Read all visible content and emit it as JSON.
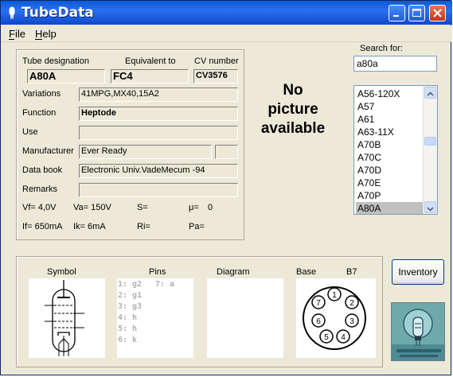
{
  "window": {
    "title": "TubeData",
    "controls": [
      "minimize",
      "maximize",
      "close"
    ]
  },
  "menu": [
    {
      "label": "File",
      "key": "F"
    },
    {
      "label": "Help",
      "key": "H"
    }
  ],
  "info": {
    "labels": {
      "designation": "Tube designation",
      "equivalent": "Equivalent to",
      "cv": "CV number",
      "variations": "Variations",
      "function": "Function",
      "use": "Use",
      "manufacturer": "Manufacturer",
      "databook": "Data book",
      "remarks": "Remarks"
    },
    "values": {
      "designation": "A80A",
      "equivalent": "FC4",
      "cv": "CV3576",
      "variations": "41MPG,MX40,15A2",
      "function": "Heptode",
      "use": "",
      "manufacturer": "Ever Ready",
      "manufacturer_extra": "",
      "databook": "Electronic Univ.VadeMecum -94",
      "remarks": ""
    },
    "params": {
      "vf": "Vf= 4,0V",
      "va": "Va= 150V",
      "s": "S=",
      "mu": "μ=",
      "mu_value": "0",
      "if": "If= 650mA",
      "ik": "Ik= 6mA",
      "ri": "Ri=",
      "pa": "Pa="
    }
  },
  "no_picture": {
    "line1": "No",
    "line2": "picture",
    "line3": "available"
  },
  "search": {
    "label": "Search for:",
    "value": "a80a"
  },
  "tube_list": {
    "items": [
      "A56-120X",
      "A57",
      "A61",
      "A63-11X",
      "A70B",
      "A70C",
      "A70D",
      "A70E",
      "A70P",
      "A80A"
    ],
    "selected": "A80A"
  },
  "bottom": {
    "headers": {
      "symbol": "Symbol",
      "pins": "Pins",
      "diagram": "Diagram",
      "base": "Base",
      "base_type": "B7"
    },
    "pins": {
      "p1": "1: g2",
      "p2": "2: g1",
      "p3": "3: g3",
      "p4": "4: h",
      "p5": "5: h",
      "p6": "6: k",
      "p7": "7: a"
    },
    "socket_numbers": [
      "1",
      "2",
      "3",
      "4",
      "5",
      "6",
      "7"
    ]
  },
  "buttons": {
    "inventory": "Inventory"
  },
  "colors": {
    "titlebar": "#0a5bd6",
    "window_bg": "#ece9d8",
    "close_button": "#c2351a",
    "selection": "#c0c0c0"
  }
}
